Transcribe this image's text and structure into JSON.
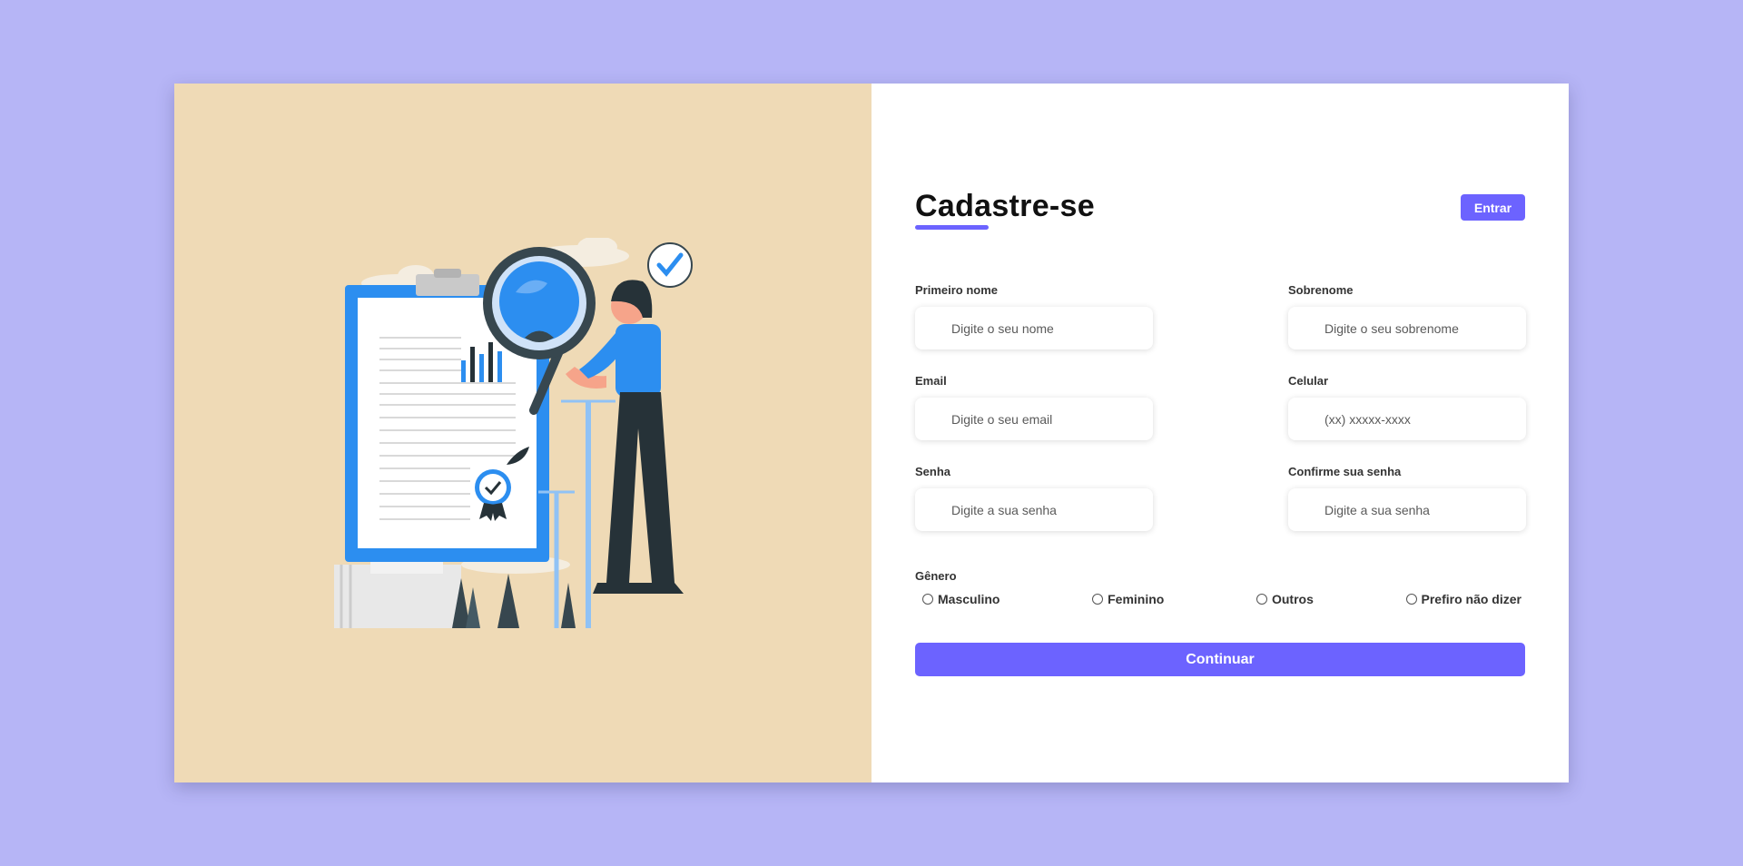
{
  "form": {
    "title": "Cadastre-se",
    "login_button": "Entrar",
    "fields": {
      "first_name": {
        "label": "Primeiro nome",
        "placeholder": "Digite o seu nome"
      },
      "last_name": {
        "label": "Sobrenome",
        "placeholder": "Digite o seu sobrenome"
      },
      "email": {
        "label": "Email",
        "placeholder": "Digite o seu email"
      },
      "phone": {
        "label": "Celular",
        "placeholder": "(xx) xxxxx-xxxx"
      },
      "password": {
        "label": "Senha",
        "placeholder": "Digite a sua senha"
      },
      "confirm_password": {
        "label": "Confirme sua senha",
        "placeholder": "Digite a sua senha"
      }
    },
    "gender": {
      "label": "Gênero",
      "options": [
        "Masculino",
        "Feminino",
        "Outros",
        "Prefiro não dizer"
      ]
    },
    "submit_button": "Continuar"
  },
  "colors": {
    "page_background": "#b6b5f6",
    "illustration_panel": "#efdab6",
    "accent": "#6c63ff",
    "illustration_blue": "#2c8ef0",
    "illustration_dark": "#263238"
  },
  "illustration": {
    "icon": "clipboard-magnifier-illustration"
  }
}
